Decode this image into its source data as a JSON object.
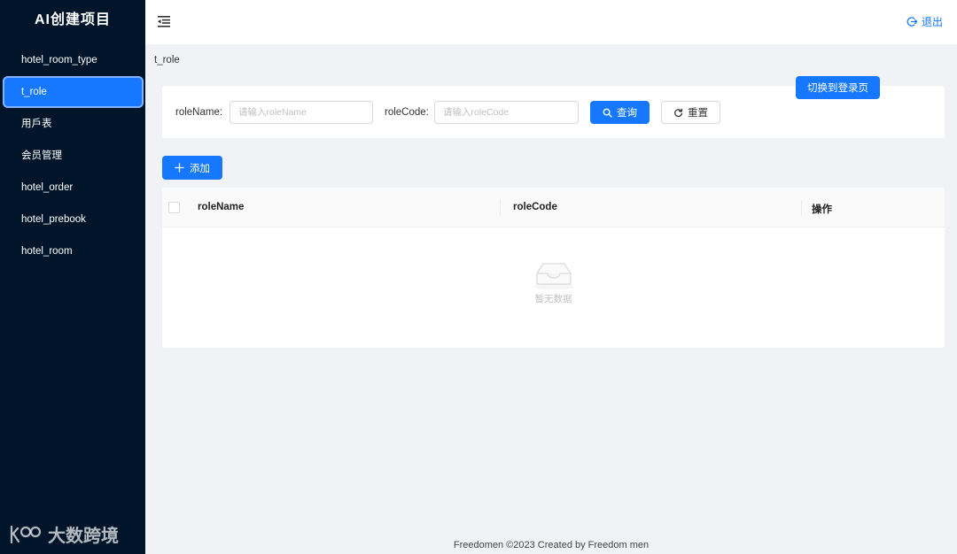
{
  "app": {
    "title": "AI创建项目"
  },
  "sidebar": {
    "items": [
      {
        "label": "hotel_room_type"
      },
      {
        "label": "t_role"
      },
      {
        "label": "用戶表"
      },
      {
        "label": "会员管理"
      },
      {
        "label": "hotel_order"
      },
      {
        "label": "hotel_prebook"
      },
      {
        "label": "hotel_room"
      }
    ],
    "active_index": 1
  },
  "watermark": {
    "text": "大数跨境",
    "logo_glyph": "k00"
  },
  "header": {
    "logout_label": "退出"
  },
  "breadcrumb": {
    "current": "t_role"
  },
  "search": {
    "fields": [
      {
        "label": "roleName",
        "placeholder": "请输入roleName",
        "value": ""
      },
      {
        "label": "roleCode",
        "placeholder": "请输入roleCode",
        "value": ""
      }
    ],
    "separator": ":",
    "query_label": "查询",
    "reset_label": "重置"
  },
  "switch_button_label": "切换到登录页",
  "add_button_label": "添加",
  "table": {
    "columns": [
      "roleName",
      "roleCode",
      "操作"
    ],
    "rows": [],
    "empty_text": "暂无数据"
  },
  "footer": {
    "text": "Freedomen ©2023 Created by Freedom men"
  },
  "colors": {
    "primary": "#1677ff",
    "sider_bg": "#001529",
    "page_bg": "#f0f2f5"
  }
}
